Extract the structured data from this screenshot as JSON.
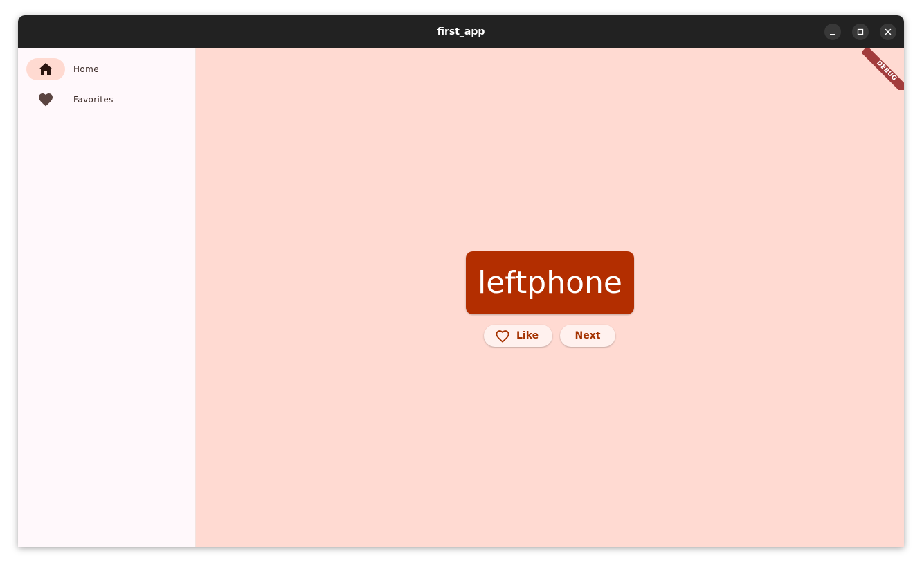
{
  "window": {
    "title": "first_app",
    "controls": {
      "minimize": "minimize-icon",
      "maximize": "maximize-icon",
      "close": "close-icon"
    }
  },
  "sidebar": {
    "items": [
      {
        "label": "Home",
        "icon": "home-icon",
        "selected": true
      },
      {
        "label": "Favorites",
        "icon": "heart-icon",
        "selected": false
      }
    ]
  },
  "main": {
    "word": "leftphone",
    "like_label": "Like",
    "next_label": "Next"
  },
  "debug_banner": "DEBUG",
  "colors": {
    "titlebar": "#222222",
    "sidebar_bg": "#fff8fb",
    "main_bg": "#ffdad2",
    "card": "#b32e00",
    "button_bg": "#fff1ee",
    "button_text": "#a43200",
    "nav_indicator": "#ffdad1",
    "debug_ribbon": "#a23c3c"
  }
}
